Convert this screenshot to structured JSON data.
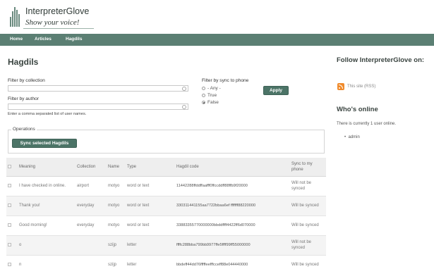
{
  "site": {
    "name": "InterpreterGlove",
    "slogan": "Show your voice!"
  },
  "nav": {
    "items": [
      "Home",
      "Articles",
      "Hagdils"
    ]
  },
  "page": {
    "title": "Hagdils"
  },
  "filters": {
    "collection_label": "Filter by collection",
    "collection_value": "",
    "author_label": "Filter by author",
    "author_value": "",
    "author_description": "Enter a comma separated list of user names.",
    "sync_label": "Filter by sync to phone",
    "sync_options": [
      "- Any -",
      "True",
      "False"
    ],
    "sync_selected": "False",
    "apply_label": "Apply"
  },
  "operations": {
    "legend": "Operations",
    "sync_button_label": "Sync selected Hagdils"
  },
  "table": {
    "headers": [
      "Meaning",
      "Collection",
      "Name",
      "Type",
      "Hagdil code",
      "Sync to my phone"
    ],
    "rows": [
      {
        "meaning": "I have checked in online.",
        "collection": "airport",
        "name": "motyo",
        "type": "word or text",
        "code": "11442288ffddffaafff0ffccddff88ffb9f20000",
        "sync": "Will not be synced"
      },
      {
        "meaning": "Thank you!",
        "collection": "everyday",
        "name": "motyo",
        "type": "word or text",
        "code": "330311441155aa7722bbaa6ef fffffff88220000",
        "sync": "Will be synced"
      },
      {
        "meaning": "Good morning!",
        "collection": "everyday",
        "name": "motyo",
        "type": "word or text",
        "code": "33883355770000000bbddffff4422ff6d070000",
        "sync": "Will be synced"
      },
      {
        "meaning": "o",
        "collection": "",
        "name": "szijp",
        "type": "letter",
        "code": "ffffc288bba799bb9977ffe5ffff99ff55000000",
        "sync": "Will not be synced"
      },
      {
        "meaning": "n",
        "collection": "",
        "name": "szijp",
        "type": "letter",
        "code": "bbdeff44dd76fffffeefffcceff88e044440000",
        "sync": "Will be synced"
      }
    ]
  },
  "sidebar": {
    "follow_title": "Follow InterpreterGlove on:",
    "rss_label": "This site (RSS)",
    "online_title": "Who's online",
    "online_text": "There is currently 1 user online.",
    "online_users": [
      "admin"
    ]
  },
  "colors": {
    "brand": "#5b7f73",
    "button": "#4c7467",
    "rss": "#f08b2c"
  }
}
